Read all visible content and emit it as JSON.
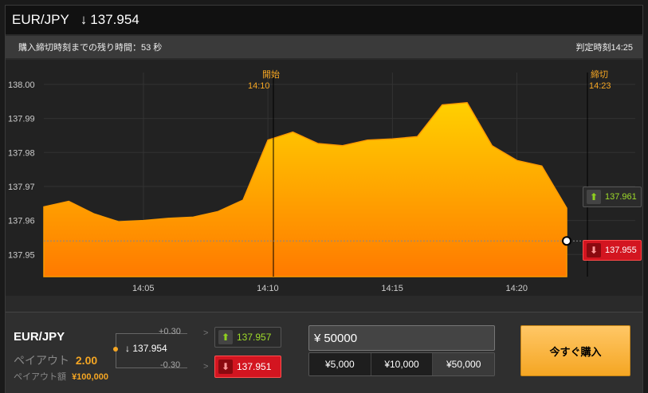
{
  "header": {
    "pair": "EUR/JPY",
    "arrow": "↓",
    "price": "137.954"
  },
  "subbar": {
    "countdown": "購入締切時刻までの残り時間：53 秒",
    "judge_time": "判定時刻14:25"
  },
  "chart": {
    "start_label": "開始",
    "start_time": "14:10",
    "close_label": "締切",
    "close_time": "14:23",
    "y_ticks": [
      "138.00",
      "137.99",
      "137.98",
      "137.97",
      "137.96",
      "137.95"
    ],
    "x_ticks": [
      "14:05",
      "14:10",
      "14:15",
      "14:20"
    ],
    "high_tag": {
      "icon": "up-arrow-icon",
      "value": "137.961",
      "color": "#9fdc2a"
    },
    "low_tag": {
      "icon": "down-arrow-icon",
      "value": "137.955",
      "color": "#d31520"
    },
    "current_price": 137.954,
    "area_color_top": "#ffc000",
    "area_color_bottom": "#ff7a00"
  },
  "chart_data": {
    "type": "area",
    "title": "",
    "xlabel": "",
    "ylabel": "",
    "ylim": [
      137.9435,
      138.0035
    ],
    "x": [
      "14:01",
      "14:02",
      "14:03",
      "14:04",
      "14:05",
      "14:06",
      "14:07",
      "14:08",
      "14:09",
      "14:10",
      "14:11",
      "14:12",
      "14:13",
      "14:14",
      "14:15",
      "14:16",
      "14:17",
      "14:18",
      "14:19",
      "14:20",
      "14:21",
      "14:22"
    ],
    "series": [
      {
        "values": [
          137.964,
          137.966,
          137.962,
          137.96,
          137.96,
          137.961,
          137.961,
          137.963,
          137.966,
          137.984,
          137.986,
          137.983,
          137.982,
          137.984,
          137.984,
          137.985,
          137.994,
          137.995,
          137.982,
          137.978,
          137.976,
          137.964
        ]
      }
    ]
  },
  "bottom": {
    "pair": "EUR/JPY",
    "payout_label": "ペイアウト",
    "payout_value": "2.00",
    "payout_amount_label": "ペイアウト額",
    "payout_amount_value": "¥100,000",
    "ladder_up": "+0.30",
    "ladder_cur": "137.954",
    "ladder_down": "-0.30",
    "ladder_arrow": "↓",
    "chevron": ">",
    "btn_high": "137.957",
    "btn_low": "137.951",
    "currency": "¥",
    "amount_value": "50000",
    "presets": [
      "¥5,000",
      "¥10,000",
      "¥50,000"
    ],
    "buy_label": "今すぐ購入"
  }
}
